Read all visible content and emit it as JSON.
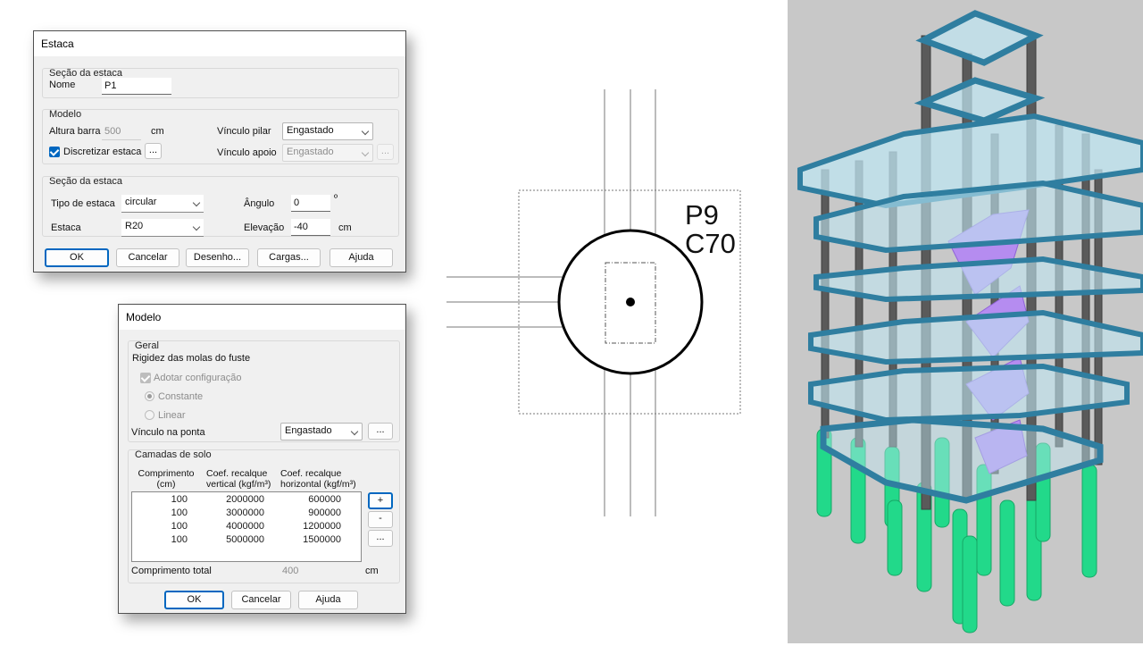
{
  "estaca_dialog": {
    "title": "Estaca",
    "secao1": {
      "title": "Seção da estaca",
      "nome_label": "Nome",
      "nome_value": "P1"
    },
    "modelo": {
      "title": "Modelo",
      "altura_label": "Altura barra",
      "altura_value": "500",
      "altura_unit": "cm",
      "discretizar_label": "Discretizar estaca",
      "discretizar_btn": "...",
      "vinculo_pilar_label": "Vínculo pilar",
      "vinculo_pilar_value": "Engastado",
      "vinculo_apoio_label": "Vínculo apoio",
      "vinculo_apoio_value": "Engastado",
      "vinculo_apoio_btn": "..."
    },
    "secao2": {
      "title": "Seção da estaca",
      "tipo_label": "Tipo de estaca",
      "tipo_value": "circular",
      "estaca_label": "Estaca",
      "estaca_value": "R20",
      "angulo_label": "Ângulo",
      "angulo_value": "0",
      "angulo_unit": "º",
      "elevacao_label": "Elevação",
      "elevacao_value": "-40",
      "elevacao_unit": "cm"
    },
    "buttons": {
      "ok": "OK",
      "cancelar": "Cancelar",
      "desenho": "Desenho...",
      "cargas": "Cargas...",
      "ajuda": "Ajuda"
    }
  },
  "modelo_dialog": {
    "title": "Modelo",
    "geral": {
      "title": "Geral",
      "rigidez_label": "Rigidez das molas do fuste",
      "adotar_label": "Adotar configuração",
      "constante_label": "Constante",
      "linear_label": "Linear",
      "vinculo_ponta_label": "Vínculo na ponta",
      "vinculo_ponta_value": "Engastado",
      "vinculo_ponta_btn": "..."
    },
    "camadas": {
      "title": "Camadas de solo",
      "col1": "Comprimento\n(cm)",
      "col2": "Coef. recalque\nvertical (kgf/m³)",
      "col3": "Coef. recalque\nhorizontal (kgf/m³)",
      "rows": [
        [
          "100",
          "2000000",
          "600000"
        ],
        [
          "100",
          "3000000",
          "900000"
        ],
        [
          "100",
          "4000000",
          "1200000"
        ],
        [
          "100",
          "5000000",
          "1500000"
        ]
      ],
      "add_btn": "+",
      "remove_btn": "-",
      "more_btn": "...",
      "total_label": "Comprimento total",
      "total_value": "400",
      "total_unit": "cm"
    },
    "buttons": {
      "ok": "OK",
      "cancelar": "Cancelar",
      "ajuda": "Ajuda"
    }
  },
  "plan": {
    "label1": "P9",
    "label2": "C70"
  },
  "colors": {
    "accent": "#0067c0",
    "beam": "#2f7ea0",
    "column": "#5a5a5a",
    "pile": "#22d98a",
    "stair": "#b58cf0",
    "slab": "#bfe6f2",
    "viewport_bg": "#c8c8c8"
  }
}
